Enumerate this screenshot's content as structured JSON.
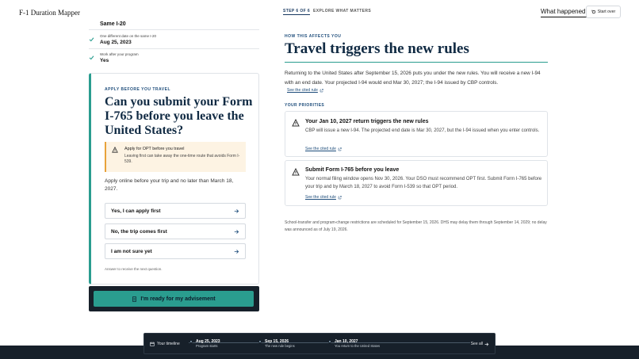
{
  "header": {
    "brand": "F-1 Duration Mapper",
    "step": "STEP 6 OF 6",
    "explore": "EXPLORE WHAT MATTERS",
    "what_happened": "What happened?",
    "start_over": "Start over"
  },
  "answers": {
    "same_value": "Same I-20",
    "items": [
      {
        "question": "One different date on the same I-20",
        "answer": "Aug 25, 2023"
      },
      {
        "question": "Work after your program",
        "answer": "Yes"
      }
    ]
  },
  "question_card": {
    "kicker": "APPLY BEFORE YOU TRAVEL",
    "title": "Can you submit your Form I-765 before you leave the United States?",
    "alert_title": "Apply for OPT before you travel",
    "alert_body": "Leaving first can take away the one-time route that avoids Form I-539.",
    "body": "Apply online before your trip and no later than March 18, 2027.",
    "options": [
      "Yes, I can apply first",
      "No, the trip comes first",
      "I am not sure yet"
    ],
    "hint": "Answer to receive the next question."
  },
  "ready_button": "I'm ready for my advisement",
  "right_panel": {
    "kicker": "HOW THIS AFFECTS YOU",
    "title": "Travel triggers the new rules",
    "paragraph": "Returning to the United States after September 15, 2026 puts you under the new rules. You will receive a new I-94 with an end date. Your projected I-94 would end Mar 30, 2027; the I-94 issued by CBP controls.",
    "link": "See the cited rule",
    "priorities_label": "YOUR PRIORITIES",
    "priorities": [
      {
        "title": "Your Jan 10, 2027 return triggers the new rules",
        "body": "CBP will issue a new I-94. The projected end date is Mar 30, 2027, but the I-94 issued when you enter controls.",
        "link": "See the cited rule"
      },
      {
        "title": "Submit Form I-765 before you leave",
        "body": "Your normal filing window opens Nov 30, 2026. Your DSO must recommend OPT first. Submit Form I-765 before your trip and by March 18, 2027 to avoid Form I-539 so that OPT period.",
        "link": "See the cited rule"
      }
    ],
    "footnote": "School-transfer and program-change restrictions are scheduled for September 15, 2026. DHS may delay them through September 14, 2029; no delay was announced as of July 19, 2026."
  },
  "timeline": {
    "label": "Your timeline",
    "events": [
      {
        "date": "Aug 25, 2023",
        "sub": "Program starts"
      },
      {
        "date": "Sep 15, 2026",
        "sub": "The new rule begins"
      },
      {
        "date": "Jan 10, 2027",
        "sub": "You return to the United States"
      }
    ],
    "see_all": "See all"
  }
}
